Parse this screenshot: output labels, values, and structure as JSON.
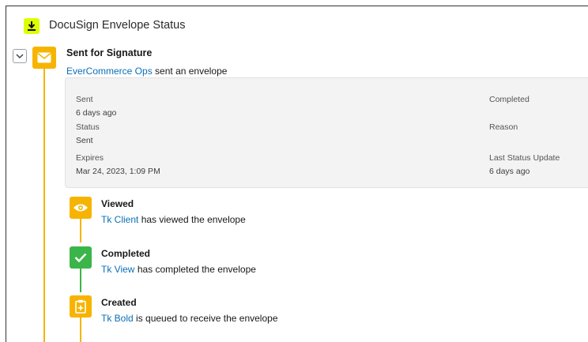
{
  "header": {
    "title": "DocuSign Envelope Status",
    "icon": "download-icon",
    "icon_color": "#ddff00"
  },
  "envelope": {
    "title": "Sent for Signature",
    "sender": "EverCommerce Ops",
    "action": "sent an envelope",
    "icon": "envelope-icon",
    "accent": "#f6b400",
    "fields": {
      "sent_label": "Sent",
      "sent_value": "6 days ago",
      "status_label": "Status",
      "status_value": "Sent",
      "expires_label": "Expires",
      "expires_value": "Mar 24, 2023, 1:09 PM",
      "completed_label": "Completed",
      "reason_label": "Reason",
      "last_update_label": "Last Status Update",
      "last_update_value": "6 days ago"
    }
  },
  "events": [
    {
      "title": "Viewed",
      "actor": "Tk Client",
      "text": "has viewed the envelope",
      "icon": "eye-icon",
      "color": "#f6b400"
    },
    {
      "title": "Completed",
      "actor": "Tk View",
      "text": "has completed the envelope",
      "icon": "checkmark-icon",
      "color": "#3bb54a"
    },
    {
      "title": "Created",
      "actor": "Tk Bold",
      "text": "is queued to receive the envelope",
      "icon": "clipboard-icon",
      "color": "#f6b400"
    }
  ]
}
